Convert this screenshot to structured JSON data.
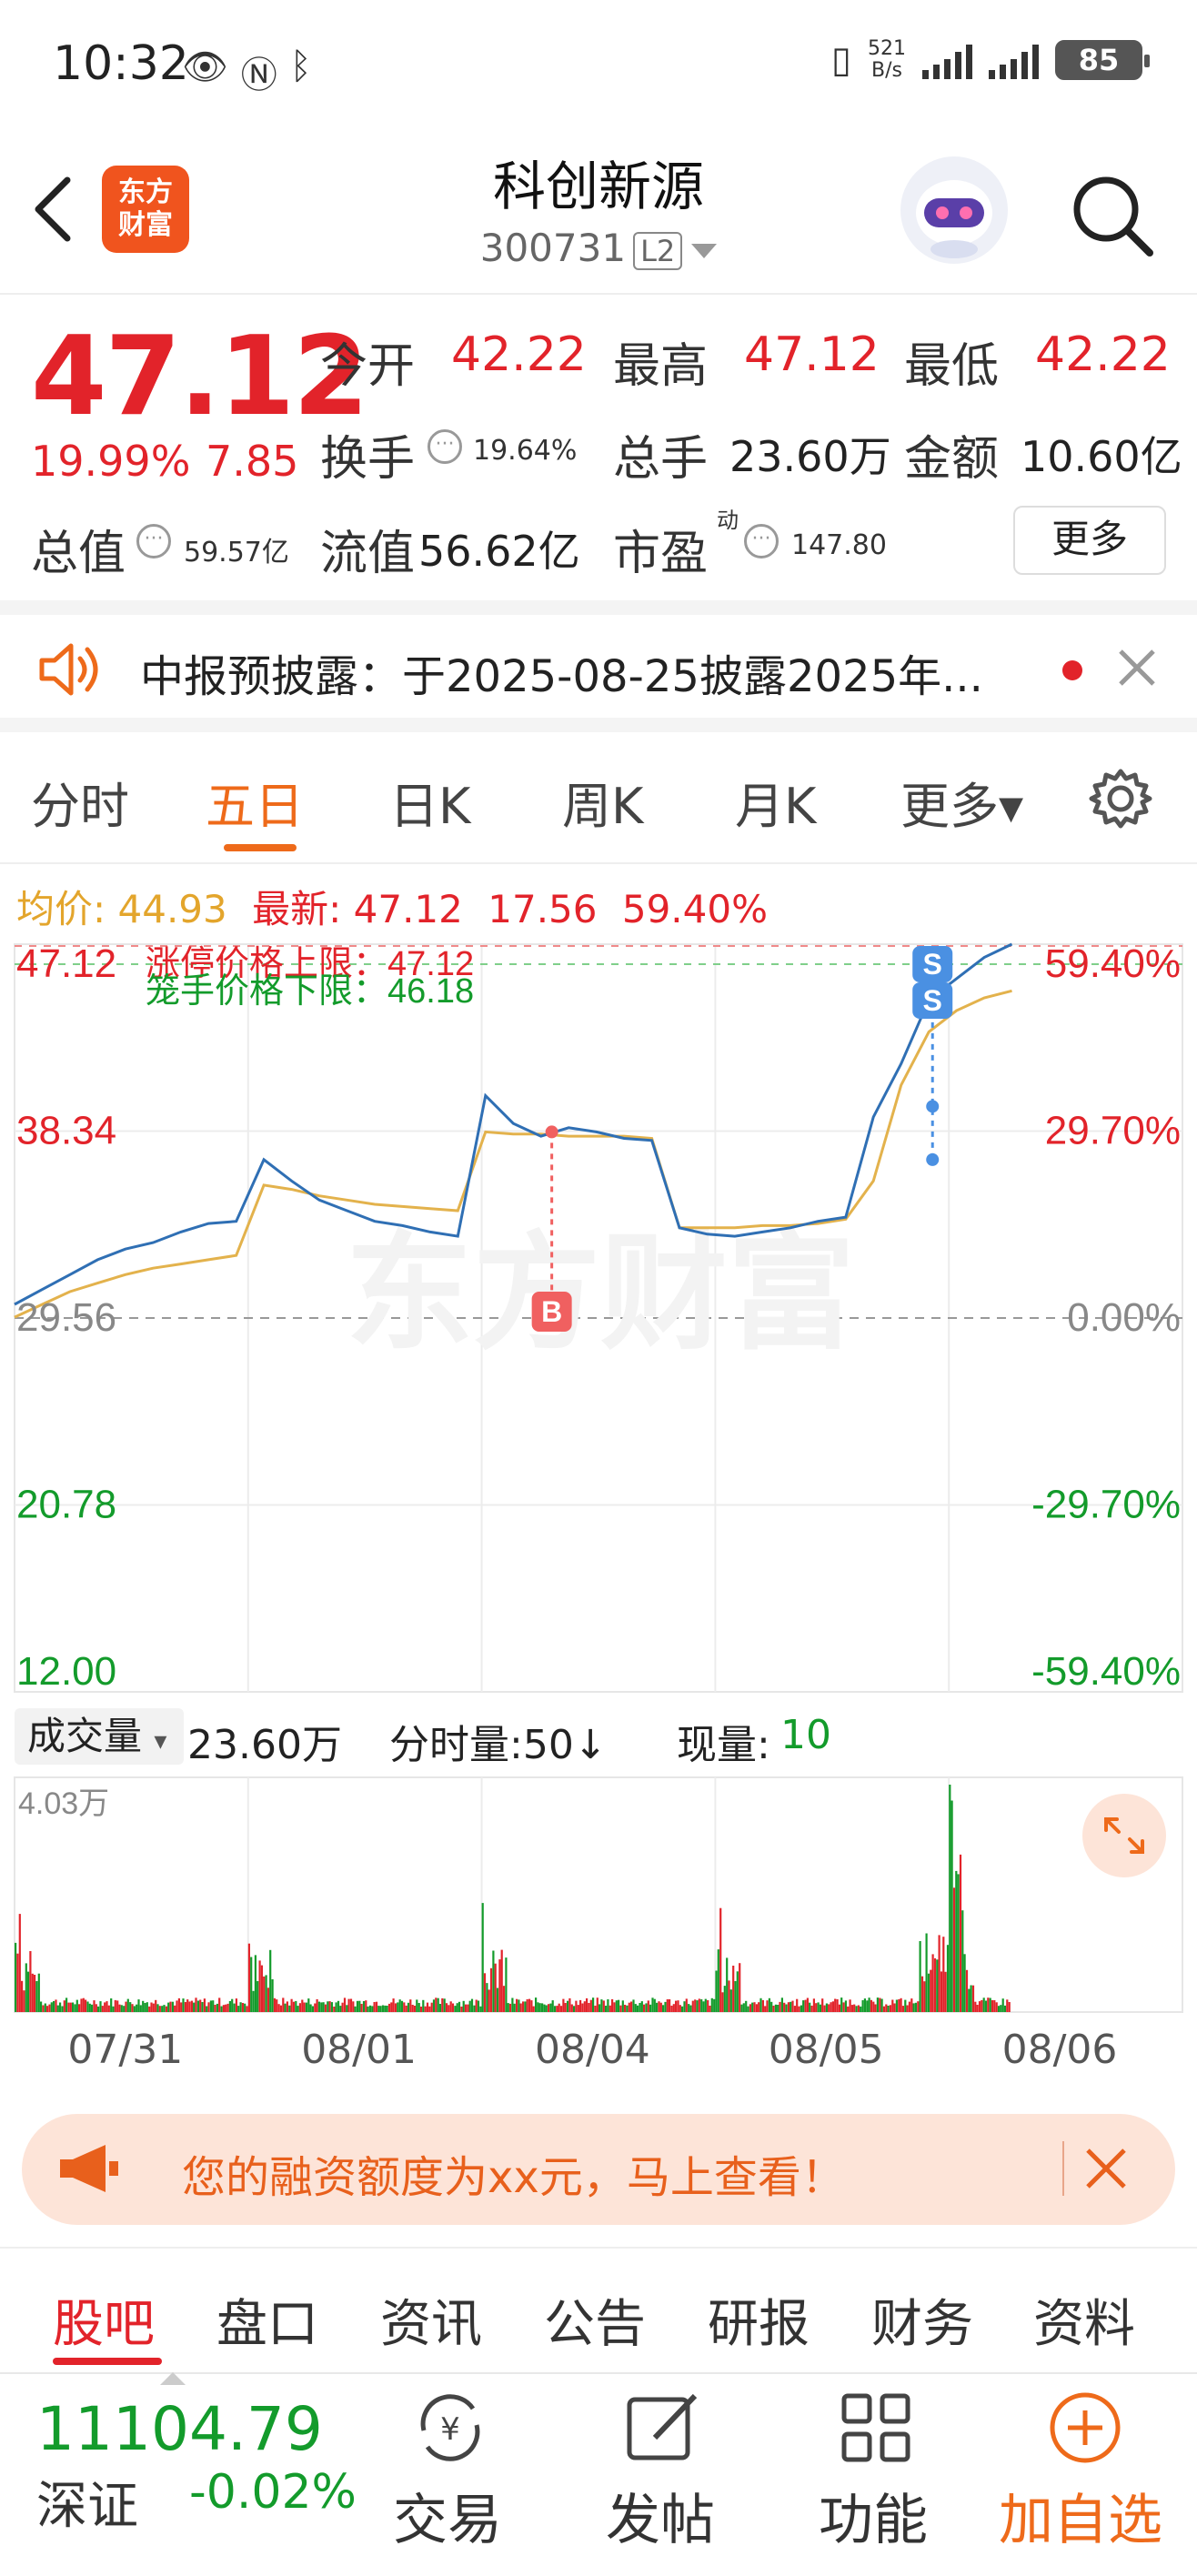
{
  "status_bar": {
    "time": "10:32",
    "net_speed_value": "521",
    "net_speed_unit": "B/s",
    "battery": "85"
  },
  "header": {
    "logo_text_line1": "东方",
    "logo_text_line2": "财富",
    "name": "科创新源",
    "code": "300731",
    "level_badge": "L2"
  },
  "quote": {
    "price": "47.12",
    "change_pct": "19.99%",
    "change": "7.85",
    "open_label": "今开",
    "open_value": "42.22",
    "high_label": "最高",
    "high_value": "47.12",
    "low_label": "最低",
    "low_value": "42.22",
    "turnover_label": "换手",
    "turnover_value": "19.64%",
    "volume_label": "总手",
    "volume_value": "23.60万",
    "amount_label": "金额",
    "amount_value": "10.60亿",
    "mktcap_label": "总值",
    "mktcap_value": "59.57亿",
    "float_label": "流值",
    "float_value": "56.62亿",
    "pe_label": "市盈",
    "pe_superscript": "动",
    "pe_value": "147.80",
    "more_button": "更多"
  },
  "notice": {
    "text": "中报预披露：于2025-08-25披露2025年..."
  },
  "chart_tabs": [
    {
      "label": "分时"
    },
    {
      "label": "五日"
    },
    {
      "label": "日K"
    },
    {
      "label": "周K"
    },
    {
      "label": "月K"
    },
    {
      "label": "更多▾"
    }
  ],
  "chart_legend": {
    "avg_label": "均价:",
    "avg_value": "44.93",
    "latest_label": "最新:",
    "latest_value": "47.12",
    "latest_change": "17.56",
    "latest_pct": "59.40%"
  },
  "chart_annotations": {
    "limit_up": "涨停价格上限：47.12",
    "limit_down": "笼手价格下限：46.18",
    "buy_marker": "B",
    "sell_marker": "S",
    "watermark": "东方财富"
  },
  "chart_data": {
    "type": "line",
    "y_left_ticks": [
      "47.12",
      "38.34",
      "29.56",
      "20.78",
      "12.00"
    ],
    "y_right_ticks": [
      "59.40%",
      "29.70%",
      "0.00%",
      "-29.70%",
      "-59.40%"
    ],
    "ylim": [
      12.0,
      47.12
    ],
    "prev_close": 29.56,
    "x_dates": [
      "07/31",
      "08/01",
      "08/04",
      "08/05",
      "08/06"
    ],
    "series": [
      {
        "name": "最新",
        "color": "#2f6fb4",
        "values": [
          30.2,
          30.9,
          31.6,
          32.3,
          32.8,
          33.1,
          33.6,
          34.0,
          34.1,
          37.0,
          36.0,
          35.1,
          34.6,
          34.1,
          33.9,
          33.6,
          33.4,
          40.0,
          38.7,
          38.1,
          38.5,
          38.3,
          38.0,
          37.9,
          33.8,
          33.5,
          33.4,
          33.6,
          33.8,
          34.1,
          34.3,
          39.0,
          41.5,
          44.5,
          45.5,
          46.5,
          47.12
        ]
      },
      {
        "name": "均价",
        "color": "#e3b24c",
        "values": [
          29.6,
          30.2,
          30.8,
          31.2,
          31.6,
          31.9,
          32.1,
          32.3,
          32.5,
          35.8,
          35.6,
          35.3,
          35.1,
          34.9,
          34.8,
          34.7,
          34.6,
          38.3,
          38.2,
          38.2,
          38.1,
          38.1,
          38.1,
          38.0,
          33.8,
          33.8,
          33.8,
          33.9,
          33.9,
          34.0,
          34.2,
          36.0,
          40.5,
          43.0,
          44.0,
          44.6,
          44.93
        ]
      }
    ]
  },
  "volume": {
    "selector_label": "成交量",
    "total": "23.60万",
    "ma_label": "分时量:50↓",
    "now_label": "现量:",
    "now_value": "10",
    "max_tick": "4.03万"
  },
  "promo": {
    "text": "您的融资额度为xx元，马上查看！"
  },
  "sub_tabs": [
    {
      "label": "股吧"
    },
    {
      "label": "盘口"
    },
    {
      "label": "资讯"
    },
    {
      "label": "公告"
    },
    {
      "label": "研报"
    },
    {
      "label": "财务"
    },
    {
      "label": "资料"
    }
  ],
  "bottom_bar": {
    "index_value": "11104.79",
    "index_name": "深证",
    "index_change": "-0.02%",
    "trade": "交易",
    "post": "发帖",
    "functions": "功能",
    "add_watch": "加自选"
  },
  "colors": {
    "up": "#e2232a",
    "down": "#139b2b",
    "accent": "#ee6a1a",
    "avg_line": "#e3b24c",
    "price_line": "#2f6fb4"
  }
}
